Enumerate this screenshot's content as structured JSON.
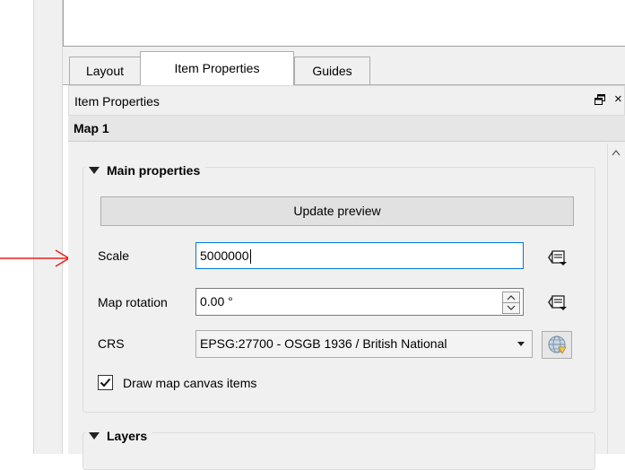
{
  "tabs": [
    {
      "label": "Layout"
    },
    {
      "label": "Item Properties"
    },
    {
      "label": "Guides"
    }
  ],
  "dock": {
    "title": "Item Properties",
    "float_icon": "float-window-icon",
    "close_icon": "close-icon",
    "close_glyph": "×"
  },
  "item": {
    "title": "Map 1"
  },
  "main_properties": {
    "title": "Main properties",
    "update_button_label": "Update preview",
    "scale": {
      "label": "Scale",
      "value": "5000000"
    },
    "rotation": {
      "label": "Map rotation",
      "value": "0.00 °"
    },
    "crs": {
      "label": "CRS",
      "value": "EPSG:27700 - OSGB 1936 / British National"
    },
    "draw_canvas_items": {
      "label": "Draw map canvas items",
      "checked": true
    }
  },
  "layers": {
    "title": "Layers"
  },
  "annotation": {
    "arrow_color": "#e8201c"
  },
  "colors": {
    "focus_border": "#0078d7",
    "panel_bg": "#f0f0f0"
  }
}
